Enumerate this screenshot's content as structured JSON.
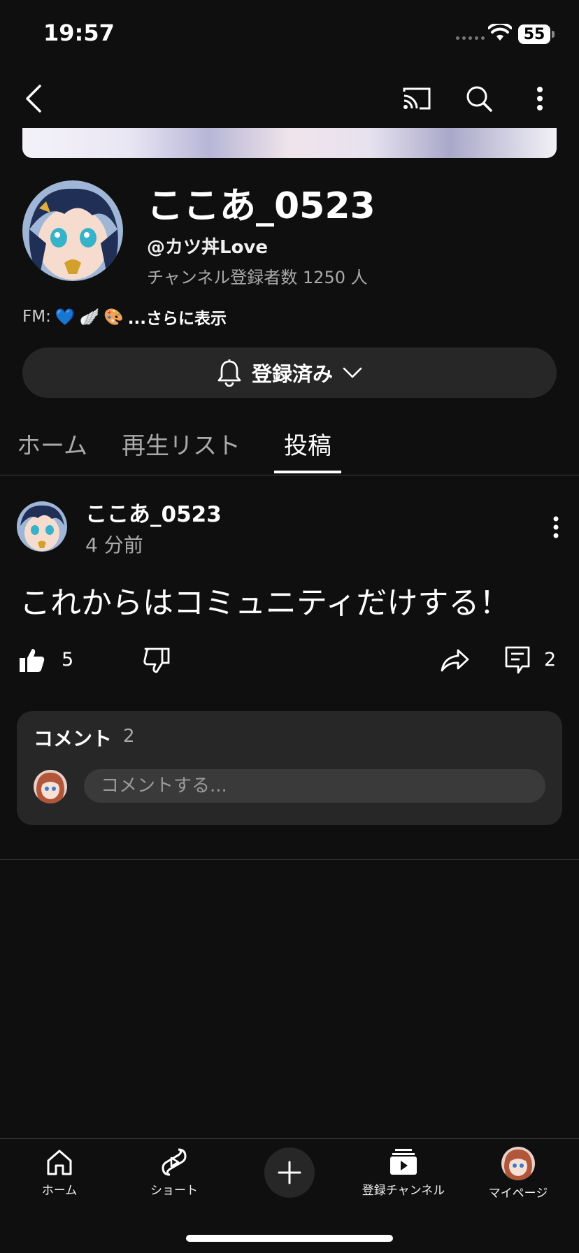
{
  "status": {
    "time": "19:57",
    "battery": "55"
  },
  "channel": {
    "name": "ここあ_0523",
    "handle": "@カツ丼Love",
    "subscribers": "チャンネル登録者数 1250 人",
    "description_prefix": "FM:",
    "description_emojis": [
      "💙",
      "🪽",
      "🎨"
    ],
    "more_link": "...さらに表示",
    "subscribe_label": "登録済み"
  },
  "tabs": [
    {
      "label": "ホーム"
    },
    {
      "label": "再生リスト"
    },
    {
      "label": "投稿",
      "active": true
    }
  ],
  "post": {
    "author": "ここあ_0523",
    "time": "4 分前",
    "text": "これからはコミュニティだけする！",
    "likes": "5",
    "comments": "2"
  },
  "comments": {
    "title": "コメント",
    "count": "2",
    "placeholder": "コメントする..."
  },
  "bottom_nav": [
    {
      "label": "ホーム",
      "icon": "home-icon"
    },
    {
      "label": "ショート",
      "icon": "shorts-icon"
    },
    {
      "label": "",
      "icon": "plus-icon"
    },
    {
      "label": "登録チャンネル",
      "icon": "subscriptions-icon"
    },
    {
      "label": "マイページ",
      "icon": "avatar"
    }
  ],
  "colors": {
    "background": "#0f0f0f",
    "surface": "#272727",
    "text": "#f1f1f1",
    "secondary": "#aaaaaa"
  }
}
